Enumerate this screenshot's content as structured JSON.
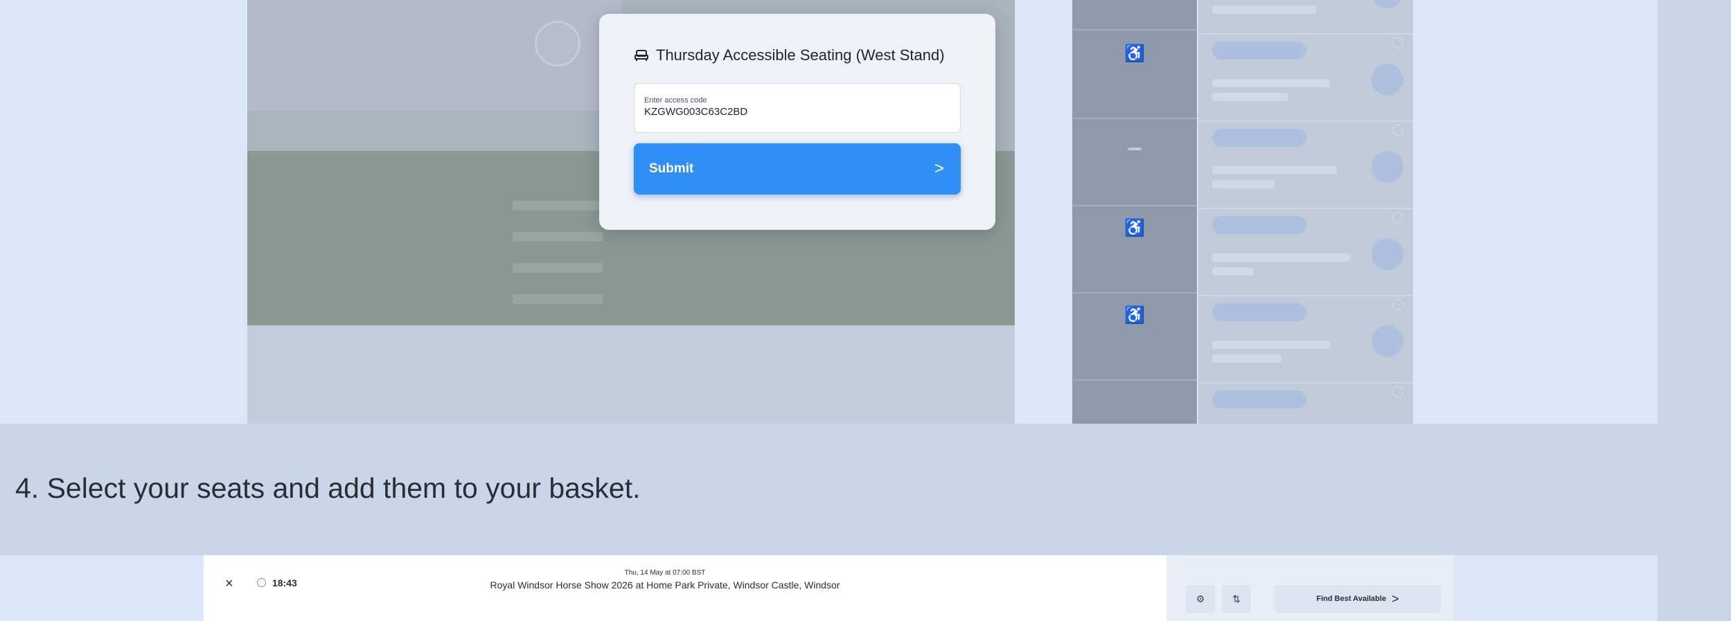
{
  "dialog": {
    "title": "Thursday Accessible Seating (West Stand)",
    "code_label": "Enter access code",
    "code_value": "KZGWG003C63C2BD",
    "submit_label": "Submit",
    "submit_chevron": ">"
  },
  "step": {
    "text": "4. Select your seats and add them to your basket."
  },
  "booking": {
    "close_icon": "×",
    "timer": "18:43",
    "event_date": "Thu, 14 May at 07:00 BST",
    "event_title": "Royal Windsor Horse Show 2026 at Home Park Private, Windsor Castle, Windsor",
    "find_best_label": "Find Best Available",
    "find_best_chevron": ">",
    "filter_icon": "⚙",
    "sort_icon": "⇅"
  },
  "colors": {
    "page_background": "#c9d6ea",
    "submit_blue": "#2f8ff4",
    "dialog_background": "#eef1f6"
  }
}
